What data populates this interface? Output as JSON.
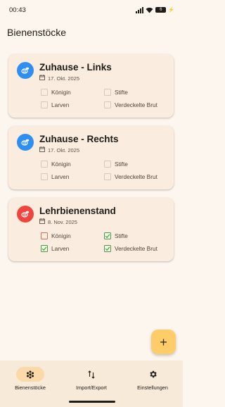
{
  "status_bar": {
    "time": "00:43",
    "battery_level": "6"
  },
  "app": {
    "title": "Bienenstöcke"
  },
  "hives": [
    {
      "name": "Zuhause - Links",
      "date": "17. Okt. 2025",
      "avatar_color": "#2f8ff0",
      "checks": [
        {
          "label": "Königin",
          "checked": false
        },
        {
          "label": "Stifte",
          "checked": false
        },
        {
          "label": "Larven",
          "checked": false
        },
        {
          "label": "Verdeckelte Brut",
          "checked": false
        }
      ]
    },
    {
      "name": "Zuhause - Rechts",
      "date": "17. Okt. 2025",
      "avatar_color": "#2f8ff0",
      "checks": [
        {
          "label": "Königin",
          "checked": false
        },
        {
          "label": "Stifte",
          "checked": false
        },
        {
          "label": "Larven",
          "checked": false
        },
        {
          "label": "Verdeckelte Brut",
          "checked": false
        }
      ]
    },
    {
      "name": "Lehrbienenstand",
      "date": "8. Nov. 2025",
      "avatar_color": "#ee463f",
      "checks": [
        {
          "label": "Königin",
          "checked": false
        },
        {
          "label": "Stifte",
          "checked": true
        },
        {
          "label": "Larven",
          "checked": true
        },
        {
          "label": "Verdeckelte Brut",
          "checked": true
        }
      ]
    }
  ],
  "fab": {
    "icon": "plus-icon",
    "label": "+"
  },
  "bottom_nav": [
    {
      "label": "Bienenstöcke",
      "icon": "hive-icon",
      "active": true
    },
    {
      "label": "Import/Export",
      "icon": "swap-vert-icon",
      "active": false
    },
    {
      "label": "Einstellungen",
      "icon": "gear-icon",
      "active": false
    }
  ]
}
